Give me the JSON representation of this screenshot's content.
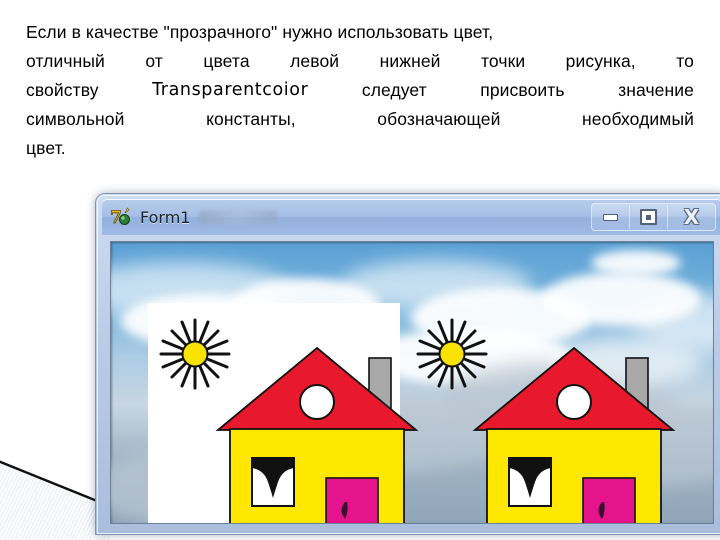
{
  "paragraph": {
    "lines": [
      [
        "Если в качестве \"прозрачного\" нужно использовать цвет,"
      ],
      [
        "отличный",
        "от",
        "цвета",
        "левой",
        "нижней",
        "точки",
        "рисунка,",
        "то"
      ],
      [
        "свойству",
        "Transparentcoior",
        "следует",
        "присвоить",
        "значение"
      ],
      [
        "символьной",
        "константы,",
        "обозначающей",
        "необходимый"
      ],
      [
        "цвет."
      ]
    ],
    "code_term": "Transparentcoior"
  },
  "window": {
    "title": "Form1",
    "icon_name": "delphi-form-icon",
    "buttons": {
      "minimize": "—",
      "maximize": "□",
      "close": "X"
    },
    "blurred_title_suffix": ""
  },
  "scene": {
    "left_picture": {
      "label": "opaque-white-background-image",
      "background": "#FFFFFF",
      "transparent": false
    },
    "right_picture": {
      "label": "transparent-background-image",
      "transparent": true
    },
    "colors": {
      "roof": "#E8192C",
      "walls": "#FFE800",
      "door": "#E6148C",
      "chimney": "#A8A8A8",
      "sun": "#F9E200",
      "outline": "#111111",
      "attic_window": "#FFFFFF",
      "sky_top": "#5AA0D4",
      "cloud": "#FFFFFF"
    }
  },
  "titlebar_colors": {
    "gradient_top": "#B8CDEC",
    "gradient_bottom": "#9FBBE6"
  }
}
